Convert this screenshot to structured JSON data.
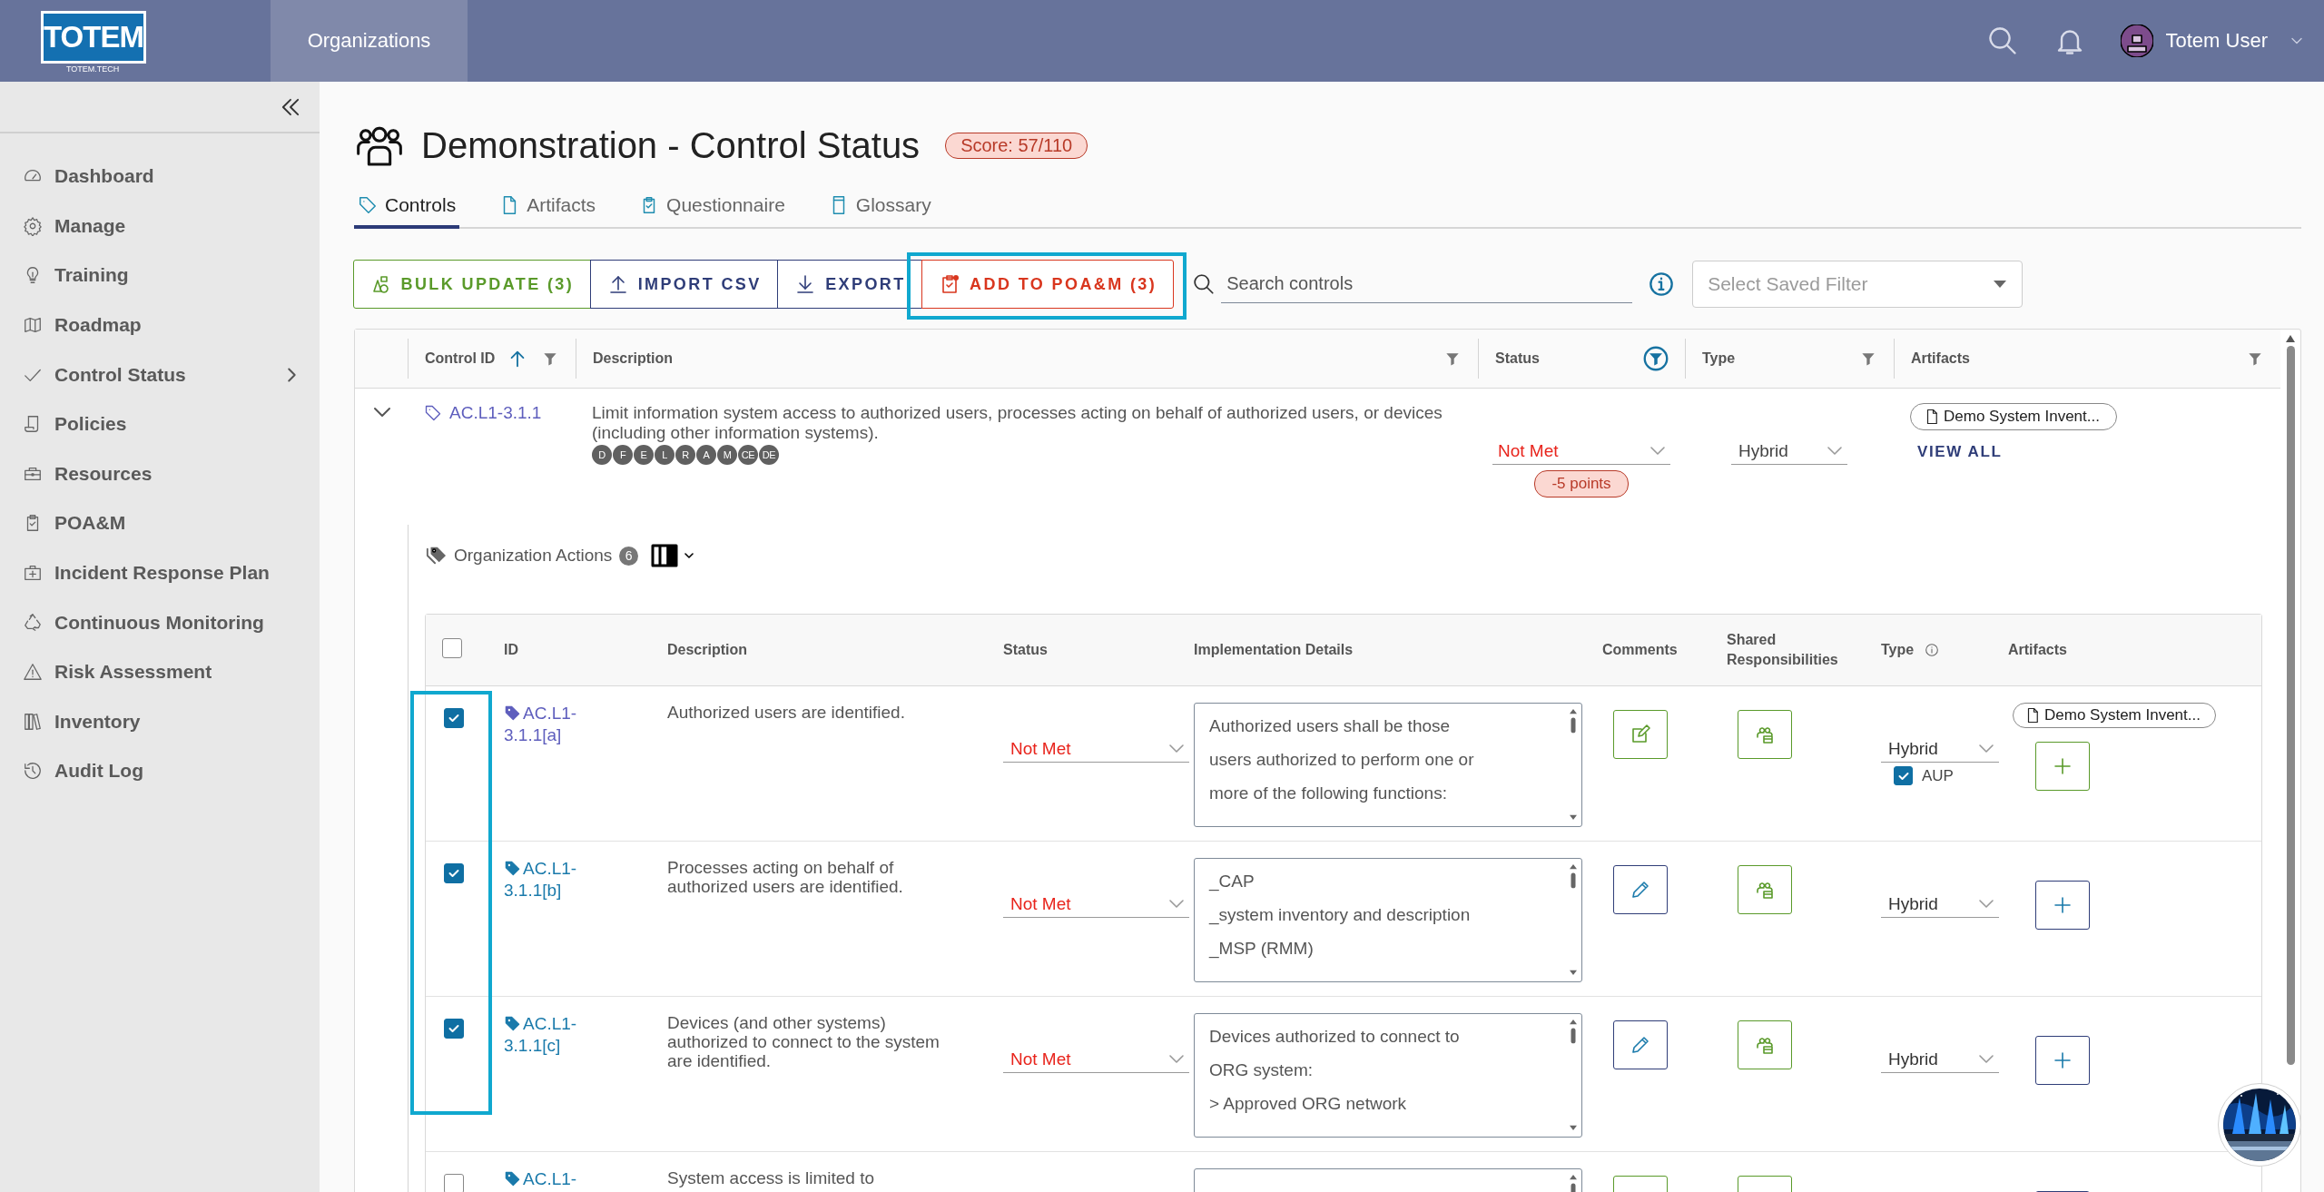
{
  "topbar": {
    "logo": {
      "text": "TOTEM",
      "subtext": "TOTEM.TECH"
    },
    "nav": [
      {
        "label": "Organizations",
        "selected": true
      }
    ],
    "user": {
      "name": "Totem User"
    }
  },
  "sidebar": {
    "items": [
      {
        "label": "Dashboard",
        "has_submenu": false
      },
      {
        "label": "Manage",
        "has_submenu": false
      },
      {
        "label": "Training",
        "has_submenu": false
      },
      {
        "label": "Roadmap",
        "has_submenu": false
      },
      {
        "label": "Control Status",
        "has_submenu": true
      },
      {
        "label": "Policies",
        "has_submenu": false
      },
      {
        "label": "Resources",
        "has_submenu": false
      },
      {
        "label": "POA&M",
        "has_submenu": false
      },
      {
        "label": "Incident Response Plan",
        "has_submenu": false
      },
      {
        "label": "Continuous Monitoring",
        "has_submenu": false
      },
      {
        "label": "Risk Assessment",
        "has_submenu": false
      },
      {
        "label": "Inventory",
        "has_submenu": false
      },
      {
        "label": "Audit Log",
        "has_submenu": false
      }
    ]
  },
  "page": {
    "title": "Demonstration - Control Status",
    "score": "Score: 57/110"
  },
  "tabs": [
    {
      "label": "Controls",
      "selected": true
    },
    {
      "label": "Artifacts",
      "selected": false
    },
    {
      "label": "Questionnaire",
      "selected": false
    },
    {
      "label": "Glossary",
      "selected": false
    }
  ],
  "toolbar": {
    "buttons": [
      {
        "label": "BULK UPDATE (3)",
        "kind": "bulk",
        "highlighted": false
      },
      {
        "label": "IMPORT CSV",
        "kind": "import",
        "highlighted": false
      },
      {
        "label": "EXPORT",
        "kind": "export",
        "highlighted": false
      },
      {
        "label": "ADD TO POA&M (3)",
        "kind": "poam",
        "highlighted": true
      }
    ],
    "search": {
      "placeholder": "Search controls"
    },
    "saved_filter": {
      "placeholder": "Select Saved Filter"
    }
  },
  "controls_table": {
    "columns": [
      {
        "label": "Control ID",
        "sorted": true,
        "filter_active": false
      },
      {
        "label": "Description",
        "sorted": false,
        "filter_active": false
      },
      {
        "label": "Status",
        "sorted": false,
        "filter_active": true
      },
      {
        "label": "Type",
        "sorted": false,
        "filter_active": false
      },
      {
        "label": "Artifacts",
        "sorted": false,
        "filter_active": false
      }
    ],
    "rows": [
      {
        "id": "AC.L1-3.1.1",
        "expanded": true,
        "description": "Limit information system access to authorized users, processes acting on behalf of authorized users, or devices (including other information systems).",
        "badges": [
          "D",
          "F",
          "E",
          "L",
          "R",
          "A",
          "M",
          "CE",
          "DE"
        ],
        "status": "Not Met",
        "points": "-5 points",
        "type": "Hybrid",
        "artifacts": [
          "Demo System Invent..."
        ],
        "view_all": "VIEW ALL"
      }
    ]
  },
  "org_actions": {
    "title": "Organization Actions",
    "count": "6",
    "select_all_checked": false,
    "columns": [
      {
        "label": "ID",
        "info": false
      },
      {
        "label": "Description",
        "info": false
      },
      {
        "label": "Status",
        "info": false
      },
      {
        "label": "Implementation Details",
        "info": false
      },
      {
        "label": "Comments",
        "info": false
      },
      {
        "label": "Shared Responsibilities",
        "info": false
      },
      {
        "label": "Type",
        "info": true
      },
      {
        "label": "Artifacts",
        "info": false
      }
    ],
    "rows": [
      {
        "checked": true,
        "highlighted": true,
        "id": "AC.L1-3.1.1[a]",
        "visited": true,
        "description": "Authorized users are identified.",
        "status": "Not Met",
        "implementation": [
          "Authorized users shall be those",
          "users authorized to perform one or",
          "more of the following functions:"
        ],
        "has_comments": true,
        "type": "Hybrid",
        "aup": {
          "label": "AUP",
          "checked": true
        },
        "artifacts": [
          "Demo System Invent..."
        ]
      },
      {
        "checked": true,
        "highlighted": true,
        "id": "AC.L1-3.1.1[b]",
        "visited": false,
        "description": "Processes acting on behalf of authorized users are identified.",
        "status": "Not Met",
        "implementation": [
          "_CAP",
          "_system inventory and description",
          "_MSP (RMM)"
        ],
        "has_comments": false,
        "type": "Hybrid",
        "artifacts": []
      },
      {
        "checked": true,
        "highlighted": true,
        "id": "AC.L1-3.1.1[c]",
        "visited": false,
        "description": "Devices (and other systems) authorized to connect to the system are identified.",
        "status": "Not Met",
        "implementation": [
          "Devices authorized to connect to",
          "ORG system:",
          "> Approved ORG network"
        ],
        "has_comments": false,
        "type": "Hybrid",
        "artifacts": []
      },
      {
        "checked": false,
        "highlighted": false,
        "id": "AC.L1-",
        "visited": false,
        "description": "System access is limited to",
        "has_comments": true,
        "artifacts": []
      }
    ]
  }
}
